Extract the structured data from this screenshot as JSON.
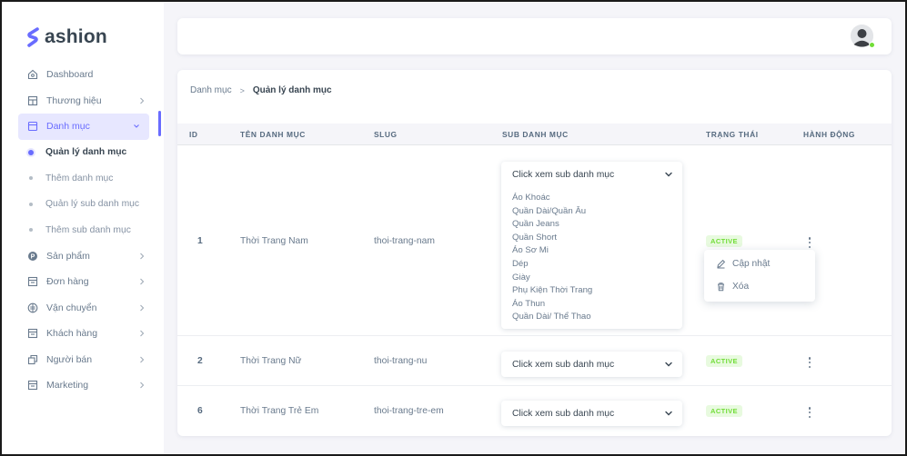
{
  "brand": {
    "logo_letter": "$",
    "name": "ashion",
    "accent": "#696cff"
  },
  "sidebar": {
    "items": [
      {
        "label": "Dashboard",
        "icon": "home-icon",
        "has_chevron": false
      },
      {
        "label": "Thương hiệu",
        "icon": "store-icon",
        "has_chevron": true
      },
      {
        "label": "Danh mục",
        "icon": "folder-icon",
        "has_chevron": true,
        "active": true
      }
    ],
    "sub_items": [
      {
        "label": "Quản lý danh mục",
        "current": true
      },
      {
        "label": "Thêm danh mục",
        "current": false
      },
      {
        "label": "Quản lý sub danh mục",
        "current": false
      },
      {
        "label": "Thêm sub danh mục",
        "current": false
      }
    ],
    "items_after": [
      {
        "label": "Sản phẩm",
        "icon": "product-icon"
      },
      {
        "label": "Đơn hàng",
        "icon": "order-icon"
      },
      {
        "label": "Vận chuyển",
        "icon": "shipping-icon"
      },
      {
        "label": "Khách hàng",
        "icon": "customer-icon"
      },
      {
        "label": "Người bán",
        "icon": "seller-icon"
      },
      {
        "label": "Marketing",
        "icon": "marketing-icon"
      }
    ]
  },
  "breadcrumb": {
    "parent": "Danh mục",
    "separator": ">",
    "current": "Quản lý danh mục"
  },
  "table": {
    "headers": [
      "ID",
      "TÊN DANH MỤC",
      "SLUG",
      "SUB DANH MỤC",
      "TRẠNG THÁI",
      "HÀNH ĐỘNG"
    ],
    "dropdown_placeholder": "Click xem sub danh mục",
    "rows": [
      {
        "id": "1",
        "name": "Thời Trang Nam",
        "slug": "thoi-trang-nam",
        "status": "ACTIVE",
        "sub_items": [
          "Áo Khoác",
          "Quần Dài/Quần Âu",
          "Quần Jeans",
          "Quần Short",
          "Áo Sơ Mi",
          "Dép",
          "Giày",
          "Phụ Kiện Thời Trang",
          "Áo Thun",
          "Quần Dài/ Thể Thao"
        ]
      },
      {
        "id": "2",
        "name": "Thời Trang Nữ",
        "slug": "thoi-trang-nu",
        "status": "ACTIVE"
      },
      {
        "id": "6",
        "name": "Thời Trang Trẻ Em",
        "slug": "thoi-trang-tre-em",
        "status": "ACTIVE"
      }
    ]
  },
  "action_menu": {
    "edit_label": "Cập nhật",
    "delete_label": "Xóa"
  },
  "colors": {
    "active_badge_bg": "#e8fadf",
    "active_badge_text": "#71dd37",
    "online": "#71dd37"
  }
}
